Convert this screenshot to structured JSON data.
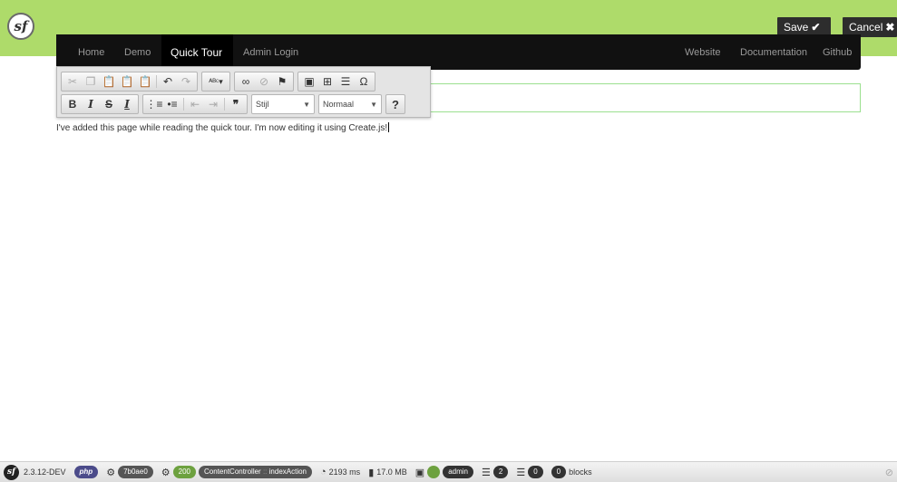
{
  "header": {
    "logo_text": "sf",
    "save_label": "Save",
    "save_icon": "✔",
    "cancel_label": "Cancel",
    "cancel_icon": "✖"
  },
  "nav": {
    "left": [
      "Home",
      "Demo",
      "Quick Tour",
      "Admin Login"
    ],
    "active": "Quick Tour",
    "right": [
      "Website",
      "Documentation",
      "Github"
    ]
  },
  "editor": {
    "style_combo": "Stijl",
    "format_combo": "Normaal",
    "help": "?",
    "content": "I've added this page while reading the quick tour. I'm now editing it using Create.js!"
  },
  "debug": {
    "version": "2.3.12-DEV",
    "php": "php",
    "token": "7b0ae0",
    "status": "200",
    "controller": "ContentController",
    "action_sep": "::",
    "action": "indexAction",
    "time": "2193 ms",
    "memory": "17.0 MB",
    "user": "admin",
    "count1": "2",
    "count2": "0",
    "blocks_count": "0",
    "blocks_label": "blocks"
  }
}
